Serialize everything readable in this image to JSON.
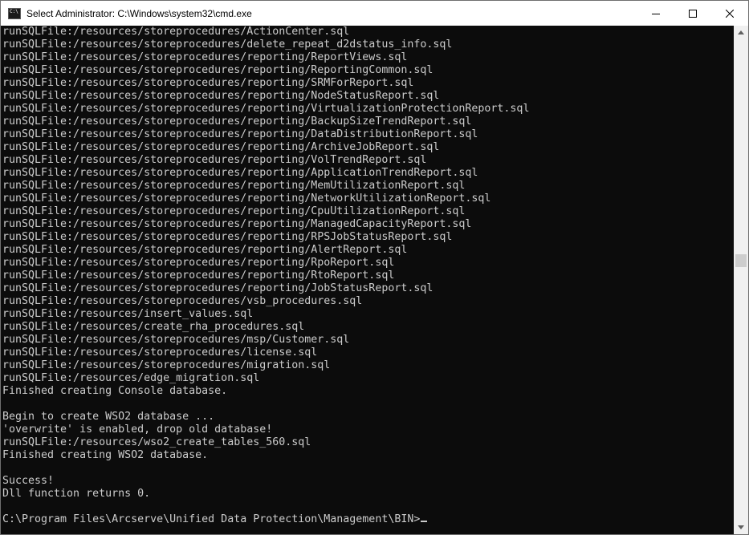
{
  "window": {
    "title": "Select Administrator: C:\\Windows\\system32\\cmd.exe",
    "icon": "cmd-icon",
    "controls": [
      "minimize-icon",
      "maximize-icon",
      "close-icon"
    ]
  },
  "console": {
    "lines": [
      "runSQLFile:/resources/storeprocedures/ActionCenter.sql",
      "runSQLFile:/resources/storeprocedures/delete_repeat_d2dstatus_info.sql",
      "runSQLFile:/resources/storeprocedures/reporting/ReportViews.sql",
      "runSQLFile:/resources/storeprocedures/reporting/ReportingCommon.sql",
      "runSQLFile:/resources/storeprocedures/reporting/SRMForReport.sql",
      "runSQLFile:/resources/storeprocedures/reporting/NodeStatusReport.sql",
      "runSQLFile:/resources/storeprocedures/reporting/VirtualizationProtectionReport.sql",
      "runSQLFile:/resources/storeprocedures/reporting/BackupSizeTrendReport.sql",
      "runSQLFile:/resources/storeprocedures/reporting/DataDistributionReport.sql",
      "runSQLFile:/resources/storeprocedures/reporting/ArchiveJobReport.sql",
      "runSQLFile:/resources/storeprocedures/reporting/VolTrendReport.sql",
      "runSQLFile:/resources/storeprocedures/reporting/ApplicationTrendReport.sql",
      "runSQLFile:/resources/storeprocedures/reporting/MemUtilizationReport.sql",
      "runSQLFile:/resources/storeprocedures/reporting/NetworkUtilizationReport.sql",
      "runSQLFile:/resources/storeprocedures/reporting/CpuUtilizationReport.sql",
      "runSQLFile:/resources/storeprocedures/reporting/ManagedCapacityReport.sql",
      "runSQLFile:/resources/storeprocedures/reporting/RPSJobStatusReport.sql",
      "runSQLFile:/resources/storeprocedures/reporting/AlertReport.sql",
      "runSQLFile:/resources/storeprocedures/reporting/RpoReport.sql",
      "runSQLFile:/resources/storeprocedures/reporting/RtoReport.sql",
      "runSQLFile:/resources/storeprocedures/reporting/JobStatusReport.sql",
      "runSQLFile:/resources/storeprocedures/vsb_procedures.sql",
      "runSQLFile:/resources/insert_values.sql",
      "runSQLFile:/resources/create_rha_procedures.sql",
      "runSQLFile:/resources/storeprocedures/msp/Customer.sql",
      "runSQLFile:/resources/storeprocedures/license.sql",
      "runSQLFile:/resources/storeprocedures/migration.sql",
      "runSQLFile:/resources/edge_migration.sql",
      "Finished creating Console database.",
      "",
      "Begin to create WSO2 database ...",
      "'overwrite' is enabled, drop old database!",
      "runSQLFile:/resources/wso2_create_tables_560.sql",
      "Finished creating WSO2 database.",
      "",
      "Success!",
      "Dll function returns 0.",
      ""
    ],
    "prompt": "C:\\Program Files\\Arcserve\\Unified Data Protection\\Management\\BIN>"
  }
}
